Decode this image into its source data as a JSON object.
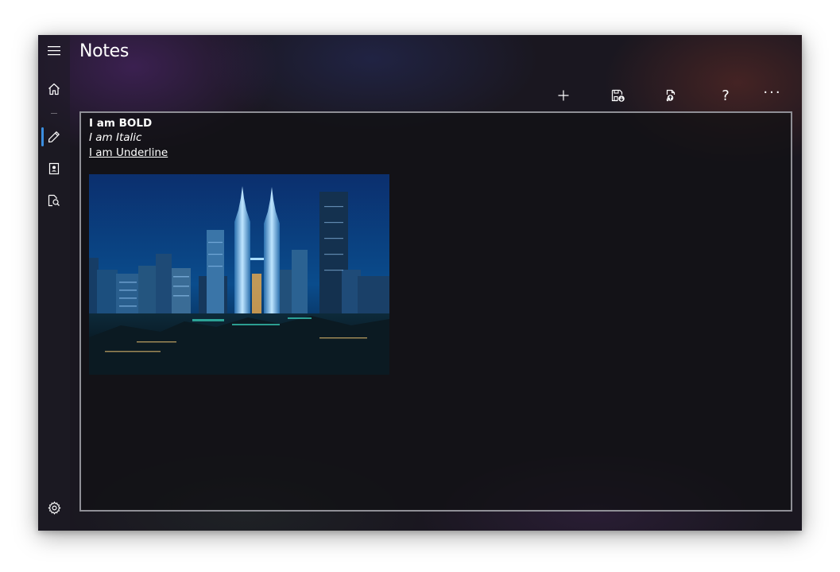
{
  "app": {
    "title": "Notes"
  },
  "nav": {
    "items": [
      {
        "name": "home",
        "icon": "home-icon"
      },
      {
        "name": "edit",
        "icon": "pencil-icon",
        "selected": true
      },
      {
        "name": "contacts",
        "icon": "contact-card-icon"
      },
      {
        "name": "search-documents",
        "icon": "document-search-icon"
      }
    ],
    "settings_icon": "gear-icon"
  },
  "toolbar": {
    "buttons": [
      {
        "name": "add",
        "icon": "plus-icon"
      },
      {
        "name": "save",
        "icon": "save-icon"
      },
      {
        "name": "open",
        "icon": "open-file-icon"
      },
      {
        "name": "help",
        "icon": "question-icon",
        "label": "?"
      },
      {
        "name": "more",
        "icon": "ellipsis-icon",
        "label": "···"
      }
    ]
  },
  "editor": {
    "lines": [
      {
        "text": "I am BOLD",
        "style": "bold"
      },
      {
        "text": "I am Italic",
        "style": "italic"
      },
      {
        "text": "I am Underline",
        "style": "underline"
      }
    ],
    "image": {
      "subject": "night city skyline with twin towers"
    }
  },
  "colors": {
    "accent": "#3b8ee0",
    "border": "#8f8f96",
    "text": "#ffffff"
  }
}
